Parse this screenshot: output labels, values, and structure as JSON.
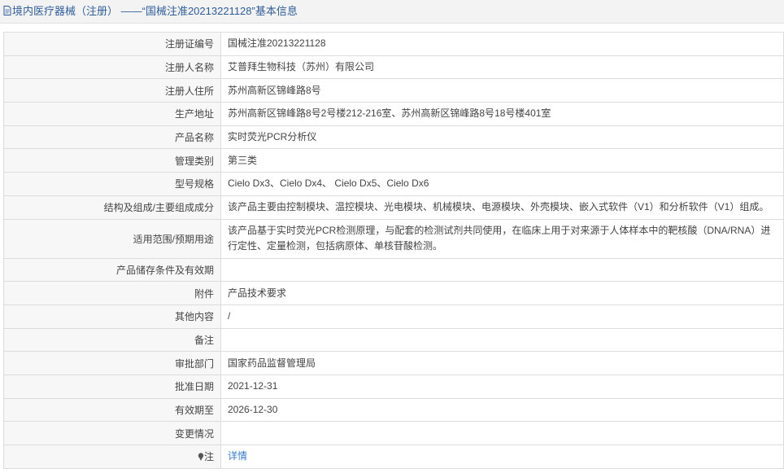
{
  "header": {
    "title": "境内医疗器械（注册） ——“国械注准20213221128”基本信息",
    "icon": "document-icon"
  },
  "rows": [
    {
      "label": "注册证编号",
      "value": "国械注准20213221128"
    },
    {
      "label": "注册人名称",
      "value": "艾普拜生物科技（苏州）有限公司"
    },
    {
      "label": "注册人住所",
      "value": "苏州高新区锦峰路8号"
    },
    {
      "label": "生产地址",
      "value": "苏州高新区锦峰路8号2号楼212-216室、苏州高新区锦峰路8号18号楼401室"
    },
    {
      "label": "产品名称",
      "value": "实时荧光PCR分析仪"
    },
    {
      "label": "管理类别",
      "value": "第三类"
    },
    {
      "label": "型号规格",
      "value": "Cielo Dx3、Cielo Dx4、 Cielo Dx5、Cielo Dx6"
    },
    {
      "label": "结构及组成/主要组成成分",
      "value": "该产品主要由控制模块、温控模块、光电模块、机械模块、电源模块、外壳模块、嵌入式软件（V1）和分析软件（V1）组成。"
    },
    {
      "label": "适用范围/预期用途",
      "value": "该产品基于实时荧光PCR检测原理，与配套的检测试剂共同使用，在临床上用于对来源于人体样本中的靶核酸（DNA/RNA）进行定性、定量检测，包括病原体、单核苷酸检测。"
    },
    {
      "label": "产品储存条件及有效期",
      "value": ""
    },
    {
      "label": "附件",
      "value": "产品技术要求"
    },
    {
      "label": "其他内容",
      "value": "/"
    },
    {
      "label": "备注",
      "value": ""
    },
    {
      "label": "审批部门",
      "value": "国家药品监督管理局"
    },
    {
      "label": "批准日期",
      "value": "2021-12-31"
    },
    {
      "label": "有效期至",
      "value": "2026-12-30"
    },
    {
      "label": "变更情况",
      "value": ""
    },
    {
      "label": "注",
      "value": "详情",
      "icon": "pin-icon",
      "link_color": "#3a7cc9"
    }
  ]
}
